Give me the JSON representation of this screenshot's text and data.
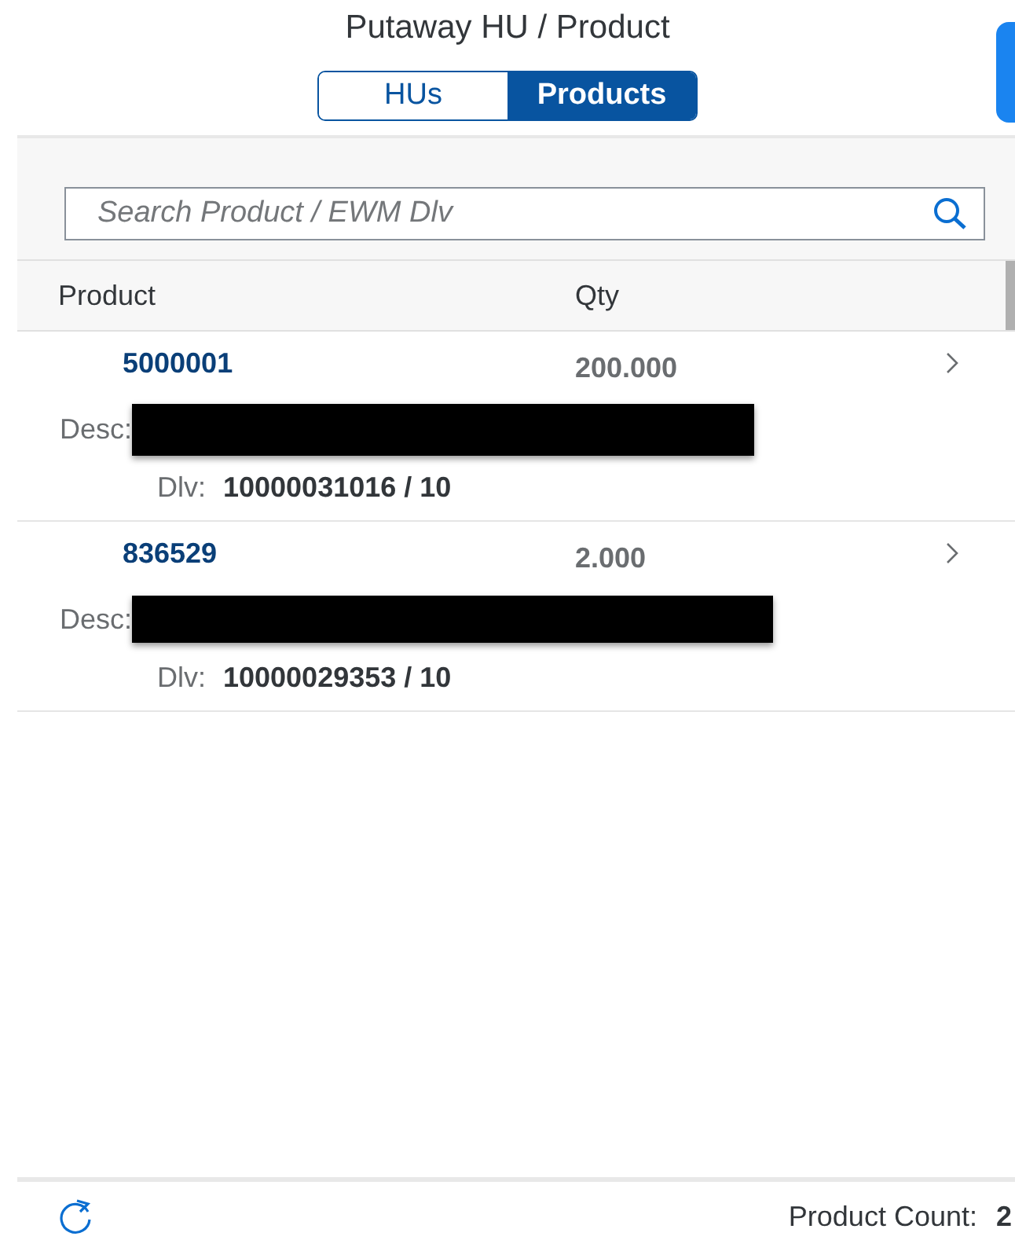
{
  "header": {
    "title": "Putaway HU / Product"
  },
  "tabs": [
    {
      "label": "HUs",
      "selected": false
    },
    {
      "label": "Products",
      "selected": true
    }
  ],
  "search": {
    "placeholder": "Search Product / EWM Dlv"
  },
  "table": {
    "columns": [
      "Product",
      "Qty"
    ],
    "rows": [
      {
        "product": "5000001",
        "qty": "200.000",
        "desc_label": "Desc:",
        "dlv_label": "Dlv:",
        "dlv": "10000031016 / 10"
      },
      {
        "product": "836529",
        "qty": "2.000",
        "desc_label": "Desc:",
        "dlv_label": "Dlv:",
        "dlv": "10000029353 / 10"
      }
    ]
  },
  "footer": {
    "count_label": "Product Count:",
    "count": "2"
  }
}
